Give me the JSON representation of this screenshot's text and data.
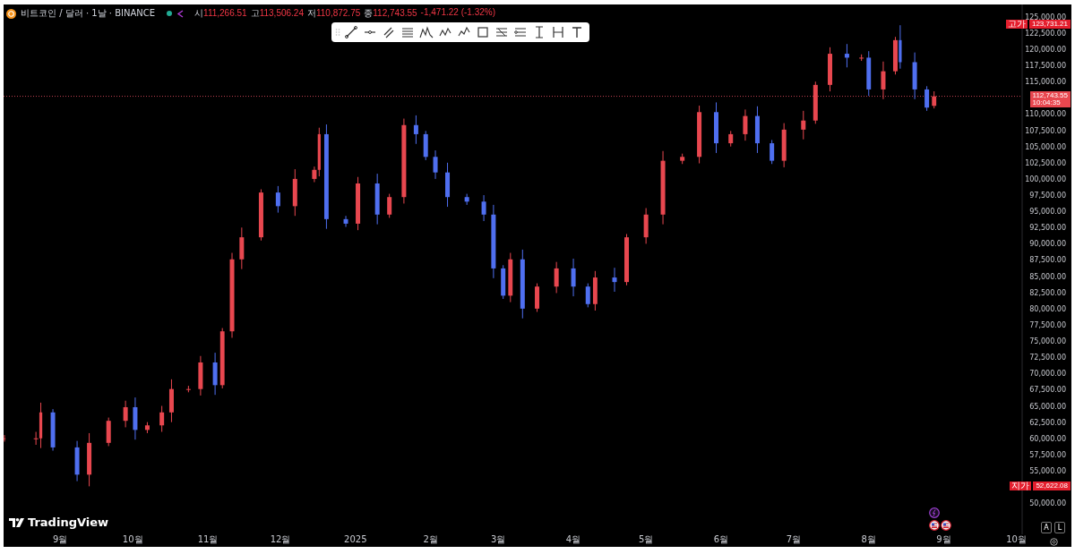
{
  "legend": {
    "symbol": "비트코인 / 달러 · 1날 · BINANCE",
    "ohlc": [
      {
        "label": "시",
        "value": "111,266.51"
      },
      {
        "label": "고",
        "value": "113,506.24"
      },
      {
        "label": "저",
        "value": "110,872.75"
      },
      {
        "label": "종",
        "value": "112,743.55"
      }
    ],
    "change": "-1,471.22 (-1.32%)"
  },
  "chart": {
    "chart_data": {
      "type": "candlestick",
      "xlim": [
        "2024-08-09",
        "2025-10-03"
      ],
      "ylim": [
        45200,
        126900
      ],
      "ref_lines": [
        {
          "axis": "y",
          "value": 112743.55,
          "color": "#c04050"
        }
      ],
      "x": [
        "2024-08-09",
        "2024-08-22",
        "2024-08-24",
        "2024-08-29",
        "2024-09-08",
        "2024-09-13",
        "2024-09-21",
        "2024-09-28",
        "2024-10-02",
        "2024-10-07",
        "2024-10-13",
        "2024-10-17",
        "2024-10-24",
        "2024-10-29",
        "2024-11-04",
        "2024-11-07",
        "2024-11-11",
        "2024-11-15",
        "2024-11-23",
        "2024-11-30",
        "2024-12-07",
        "2024-12-15",
        "2024-12-17",
        "2024-12-20",
        "2024-12-28",
        "2025-01-02",
        "2025-01-10",
        "2025-01-15",
        "2025-01-21",
        "2025-01-26",
        "2025-01-30",
        "2025-02-03",
        "2025-02-08",
        "2025-02-16",
        "2025-02-23",
        "2025-02-27",
        "2025-03-03",
        "2025-03-06",
        "2025-03-11",
        "2025-03-17",
        "2025-03-25",
        "2025-04-01",
        "2025-04-07",
        "2025-04-10",
        "2025-04-18",
        "2025-04-23",
        "2025-05-01",
        "2025-05-08",
        "2025-05-16",
        "2025-05-23",
        "2025-05-30",
        "2025-06-05",
        "2025-06-11",
        "2025-06-16",
        "2025-06-22",
        "2025-06-27",
        "2025-07-05",
        "2025-07-10",
        "2025-07-16",
        "2025-07-23",
        "2025-07-29",
        "2025-08-01",
        "2025-08-07",
        "2025-08-12",
        "2025-08-14",
        "2025-08-20",
        "2025-08-25",
        "2025-08-28"
      ],
      "ohlc": [
        [
          60000,
          60500,
          59500,
          60000
        ],
        [
          60000,
          61000,
          59000,
          60000
        ],
        [
          60000,
          65500,
          58500,
          64000
        ],
        [
          64000,
          64500,
          58100,
          58600
        ],
        [
          58600,
          59600,
          53400,
          54400
        ],
        [
          54400,
          60800,
          52600,
          59300
        ],
        [
          59300,
          63200,
          58800,
          62700
        ],
        [
          62700,
          65800,
          61700,
          64800
        ],
        [
          64800,
          66300,
          59800,
          61300
        ],
        [
          61300,
          62500,
          60800,
          62000
        ],
        [
          62000,
          65000,
          61000,
          64000
        ],
        [
          64000,
          69100,
          62500,
          67600
        ],
        [
          67600,
          68100,
          67100,
          67600
        ],
        [
          67600,
          72700,
          66600,
          71700
        ],
        [
          71700,
          73200,
          66700,
          68200
        ],
        [
          68200,
          77000,
          67700,
          76500
        ],
        [
          76500,
          88600,
          75500,
          87600
        ],
        [
          87600,
          92500,
          86100,
          91000
        ],
        [
          91000,
          98400,
          90500,
          97900
        ],
        [
          97900,
          98900,
          94800,
          95800
        ],
        [
          95800,
          101500,
          94300,
          100000
        ],
        [
          100000,
          101900,
          99500,
          101400
        ],
        [
          101400,
          107900,
          100400,
          106900
        ],
        [
          106900,
          108400,
          92300,
          93800
        ],
        [
          93800,
          94300,
          92600,
          93100
        ],
        [
          93100,
          100300,
          92100,
          99300
        ],
        [
          99300,
          100800,
          93000,
          94500
        ],
        [
          94500,
          97700,
          94000,
          97200
        ],
        [
          97200,
          109300,
          96200,
          108300
        ],
        [
          108300,
          109800,
          105400,
          106900
        ],
        [
          106900,
          107400,
          102900,
          103400
        ],
        [
          103400,
          104400,
          100000,
          101000
        ],
        [
          101000,
          102500,
          95700,
          97200
        ],
        [
          97200,
          97700,
          96000,
          96500
        ],
        [
          96500,
          97500,
          93500,
          94500
        ],
        [
          94500,
          96000,
          84700,
          86200
        ],
        [
          86200,
          86700,
          81500,
          82000
        ],
        [
          82000,
          88600,
          81000,
          87600
        ],
        [
          87600,
          89100,
          78500,
          80000
        ],
        [
          80000,
          83900,
          79500,
          83400
        ],
        [
          83400,
          87200,
          82400,
          86200
        ],
        [
          86200,
          87700,
          81900,
          83400
        ],
        [
          83400,
          83900,
          80200,
          80700
        ],
        [
          80700,
          85800,
          79700,
          84800
        ],
        [
          84800,
          86300,
          82600,
          84100
        ],
        [
          84100,
          91500,
          83600,
          91000
        ],
        [
          91000,
          95500,
          90000,
          94500
        ],
        [
          94500,
          104300,
          93000,
          102800
        ],
        [
          102800,
          103900,
          102300,
          103400
        ],
        [
          103400,
          111300,
          102400,
          110300
        ],
        [
          110300,
          111800,
          104000,
          105500
        ],
        [
          105500,
          107400,
          105000,
          106900
        ],
        [
          106900,
          110700,
          105900,
          109700
        ],
        [
          109700,
          111200,
          104000,
          105500
        ],
        [
          105500,
          106000,
          102300,
          102800
        ],
        [
          102800,
          108600,
          101800,
          107600
        ],
        [
          107600,
          110500,
          106100,
          109000
        ],
        [
          109000,
          115000,
          108500,
          114500
        ],
        [
          114500,
          120300,
          113500,
          119300
        ],
        [
          119300,
          120800,
          117200,
          118700
        ],
        [
          118700,
          119200,
          118200,
          118700
        ],
        [
          118700,
          119700,
          112800,
          113800
        ],
        [
          113800,
          118100,
          112300,
          116600
        ],
        [
          116600,
          121900,
          116100,
          121400
        ],
        [
          121400,
          123700,
          117000,
          118000
        ],
        [
          118000,
          119500,
          112300,
          113800
        ],
        [
          113800,
          114300,
          110500,
          111000
        ],
        [
          111270,
          113510,
          110870,
          112740
        ]
      ],
      "yticks": [
        {
          "value": 125000,
          "label": "125,000.00"
        },
        {
          "value": 122500,
          "label": "122,500.00"
        },
        {
          "value": 120000,
          "label": "120,000.00"
        },
        {
          "value": 117500,
          "label": "117,500.00"
        },
        {
          "value": 115000,
          "label": "115,000.00"
        },
        {
          "value": 110000,
          "label": "110,000.00"
        },
        {
          "value": 107500,
          "label": "107,500.00"
        },
        {
          "value": 105000,
          "label": "105,000.00"
        },
        {
          "value": 102500,
          "label": "102,500.00"
        },
        {
          "value": 100000,
          "label": "100,000.00"
        },
        {
          "value": 97500,
          "label": "97,500.00"
        },
        {
          "value": 95000,
          "label": "95,000.00"
        },
        {
          "value": 92500,
          "label": "92,500.00"
        },
        {
          "value": 90000,
          "label": "90,000.00"
        },
        {
          "value": 87500,
          "label": "87,500.00"
        },
        {
          "value": 85000,
          "label": "85,000.00"
        },
        {
          "value": 82500,
          "label": "82,500.00"
        },
        {
          "value": 80000,
          "label": "80,000.00"
        },
        {
          "value": 77500,
          "label": "77,500.00"
        },
        {
          "value": 75000,
          "label": "75,000.00"
        },
        {
          "value": 72500,
          "label": "72,500.00"
        },
        {
          "value": 70000,
          "label": "70,000.00"
        },
        {
          "value": 67500,
          "label": "67,500.00"
        },
        {
          "value": 65000,
          "label": "65,000.00"
        },
        {
          "value": 62500,
          "label": "62,500.00"
        },
        {
          "value": 60000,
          "label": "60,000.00"
        },
        {
          "value": 57500,
          "label": "57,500.00"
        },
        {
          "value": 55000,
          "label": "55,000.00"
        },
        {
          "value": 50000,
          "label": "50,000.00"
        }
      ],
      "xticks": [
        {
          "value": "2024-09-01",
          "label": "9월"
        },
        {
          "value": "2024-10-01",
          "label": "10월"
        },
        {
          "value": "2024-11-01",
          "label": "11월"
        },
        {
          "value": "2024-12-01",
          "label": "12월"
        },
        {
          "value": "2025-01-01",
          "label": "2025"
        },
        {
          "value": "2025-02-01",
          "label": "2월"
        },
        {
          "value": "2025-03-01",
          "label": "3월"
        },
        {
          "value": "2025-04-01",
          "label": "4월"
        },
        {
          "value": "2025-05-01",
          "label": "5월"
        },
        {
          "value": "2025-06-01",
          "label": "6월"
        },
        {
          "value": "2025-07-01",
          "label": "7월"
        },
        {
          "value": "2025-08-01",
          "label": "8월"
        },
        {
          "value": "2025-09-01",
          "label": "9월"
        },
        {
          "value": "2025-10-01",
          "label": "10월"
        }
      ]
    }
  },
  "price_markers": [
    {
      "label": "고가",
      "value": "123,731.21"
    },
    {
      "label": "지가",
      "value": "52,622.08"
    }
  ],
  "last_price": {
    "value": "112,743.55",
    "countdown": "10:04:35"
  },
  "scale_buttons": [
    {
      "label": "A"
    },
    {
      "label": "L"
    }
  ],
  "branding": "TradingView"
}
